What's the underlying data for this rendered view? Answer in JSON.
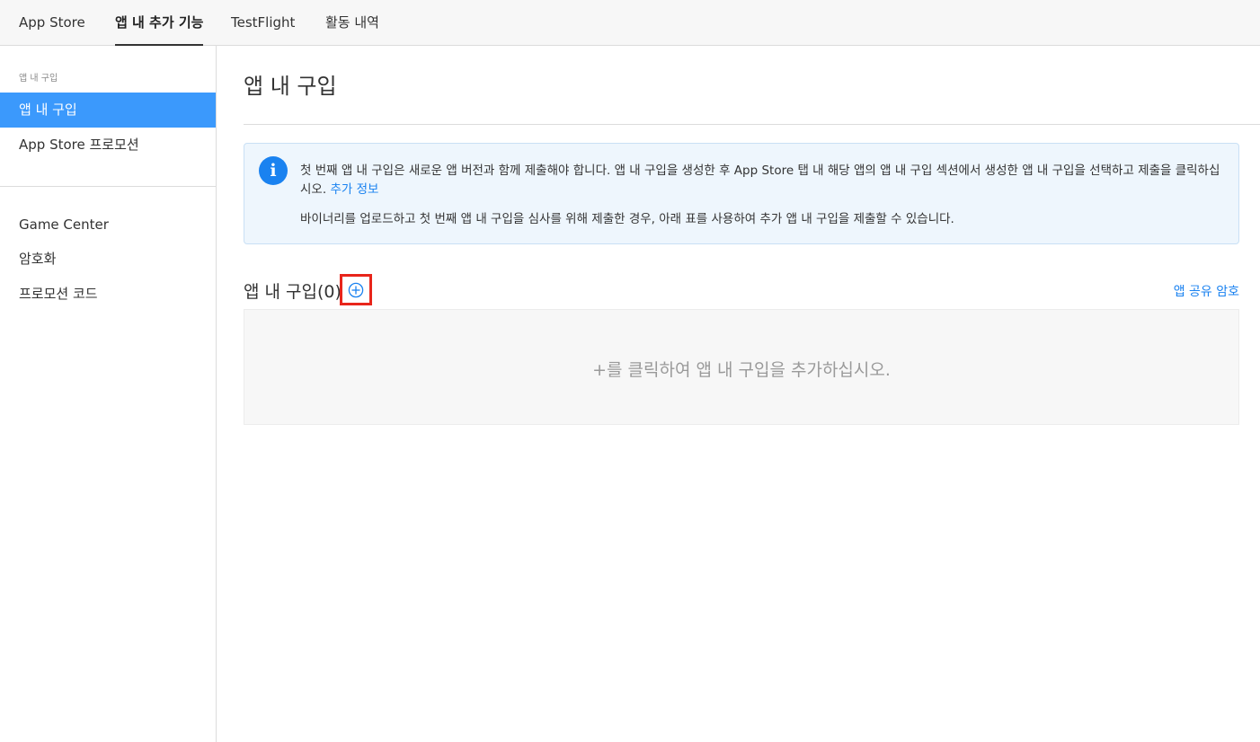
{
  "top_tabs": [
    {
      "label": "App Store"
    },
    {
      "label": "앱 내 추가 기능"
    },
    {
      "label": "TestFlight"
    },
    {
      "label": "활동 내역"
    }
  ],
  "sidebar": {
    "section_label": "앱 내 구입",
    "items": [
      {
        "label": "앱 내 구입",
        "selected": true
      },
      {
        "label": "App Store 프로모션"
      },
      {
        "label": "Game Center"
      },
      {
        "label": "암호화"
      },
      {
        "label": "프로모션 코드"
      }
    ]
  },
  "main": {
    "title": "앱 내 구입",
    "info": {
      "icon": "info-icon",
      "text1": "첫 번째 앱 내 구입은 새로운 앱 버전과 함께 제출해야 합니다. 앱 내 구입을 생성한 후 App Store 탭 내 해당 앱의 앱 내 구입 섹션에서 생성한 앱 내 구입을 선택하고 제출을 클릭하십시오.",
      "link": "추가 정보",
      "text2": "바이너리를 업로드하고 첫 번째 앱 내 구입을 심사를 위해 제출한 경우, 아래 표를 사용하여 추가 앱 내 구입을 제출할 수 있습니다."
    },
    "section_title": "앱 내 구입(0)",
    "add_icon": "plus-circle-icon",
    "share_link": "앱 공유 암호",
    "empty_text": "+를 클릭하여 앱 내 구입을 추가하십시오."
  },
  "colors": {
    "accent": "#1a82f0",
    "selected_bg": "#3b99fc",
    "highlight_box": "#e8251b"
  }
}
